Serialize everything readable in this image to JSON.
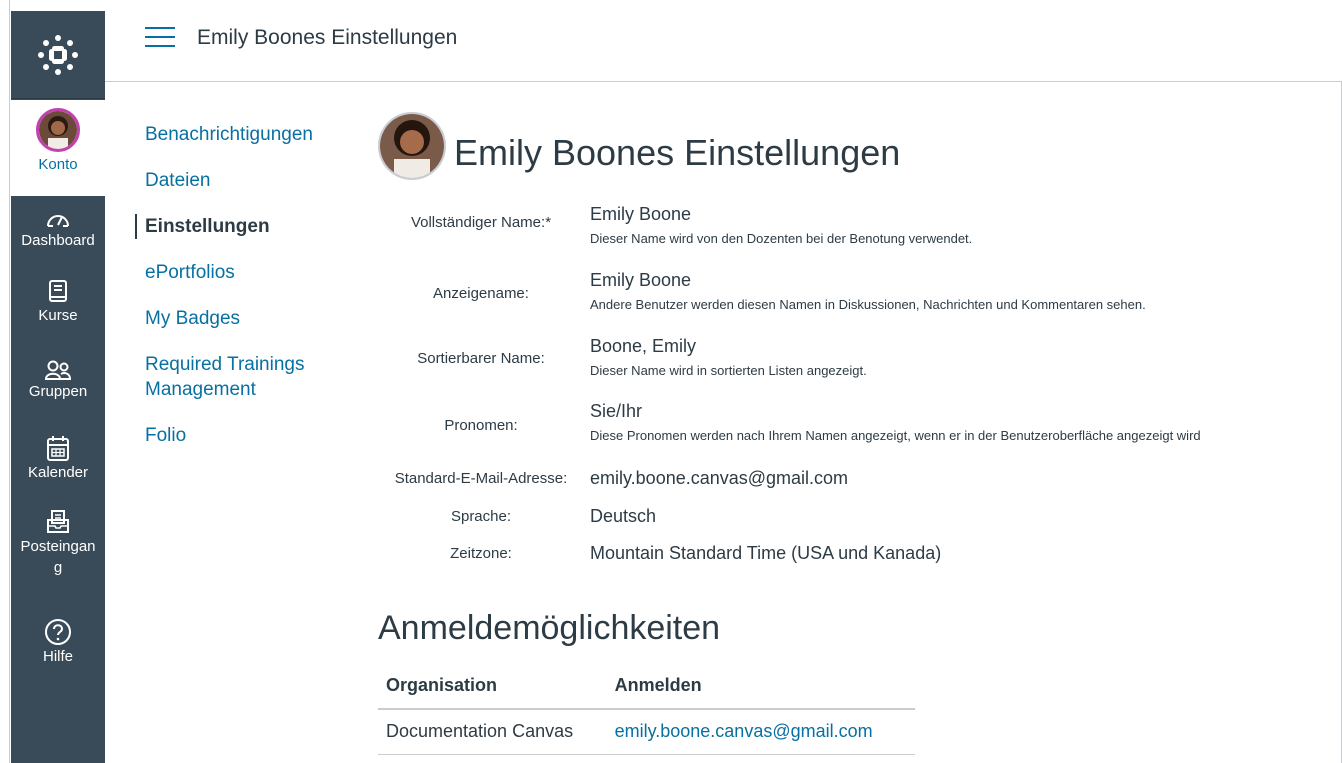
{
  "global_nav": {
    "logo_icon": "canvas-logo-icon",
    "items": [
      {
        "label": "Konto",
        "icon": "avatar"
      },
      {
        "label": "Dashboard",
        "icon": "dashboard-gauge-icon"
      },
      {
        "label": "Kurse",
        "icon": "courses-book-icon"
      },
      {
        "label": "Gruppen",
        "icon": "groups-people-icon"
      },
      {
        "label": "Kalender",
        "icon": "calendar-icon"
      },
      {
        "label": "Posteingan",
        "label_cont": "g",
        "icon": "inbox-icon"
      },
      {
        "label": "Hilfe",
        "icon": "help-question-icon"
      }
    ]
  },
  "header": {
    "breadcrumb": "Emily Boones Einstellungen"
  },
  "subnav": {
    "items": [
      {
        "label": "Benachrichtigungen"
      },
      {
        "label": "Dateien"
      },
      {
        "label": "Einstellungen"
      },
      {
        "label": "ePortfolios"
      },
      {
        "label": "My Badges"
      },
      {
        "label": "Required Trainings Management"
      },
      {
        "label": "Folio"
      }
    ]
  },
  "profile": {
    "title": "Emily Boones Einstellungen",
    "fields": [
      {
        "label": "Vollständiger Name:*",
        "value": "Emily Boone",
        "hint": "Dieser Name wird von den Dozenten bei der Benotung verwendet."
      },
      {
        "label": "Anzeigename:",
        "value": "Emily Boone",
        "hint": "Andere Benutzer werden diesen Namen in Diskussionen, Nachrichten und Kommentaren sehen."
      },
      {
        "label": "Sortierbarer Name:",
        "value": "Boone, Emily",
        "hint": "Dieser Name wird in sortierten Listen angezeigt."
      },
      {
        "label": "Pronomen:",
        "value": "Sie/Ihr",
        "hint": "Diese Pronomen werden nach Ihrem Namen angezeigt, wenn er in der Benutzeroberfläche angezeigt wird"
      },
      {
        "label": "Standard-E-Mail-Adresse:",
        "value": "emily.boone.canvas@gmail.com"
      },
      {
        "label": "Sprache:",
        "value": "Deutsch"
      },
      {
        "label": "Zeitzone:",
        "value": "Mountain Standard Time (USA und Kanada)"
      }
    ]
  },
  "logins": {
    "title": "Anmeldemöglichkeiten",
    "headers": [
      "Organisation",
      "Anmelden"
    ],
    "rows": [
      {
        "organisation": "Documentation Canvas",
        "login": "emily.boone.canvas@gmail.com"
      }
    ]
  },
  "colors": {
    "nav_bg": "#394b58",
    "link": "#0770a3",
    "text": "#2d3b45",
    "avatar_ring": "#c43fb0"
  }
}
